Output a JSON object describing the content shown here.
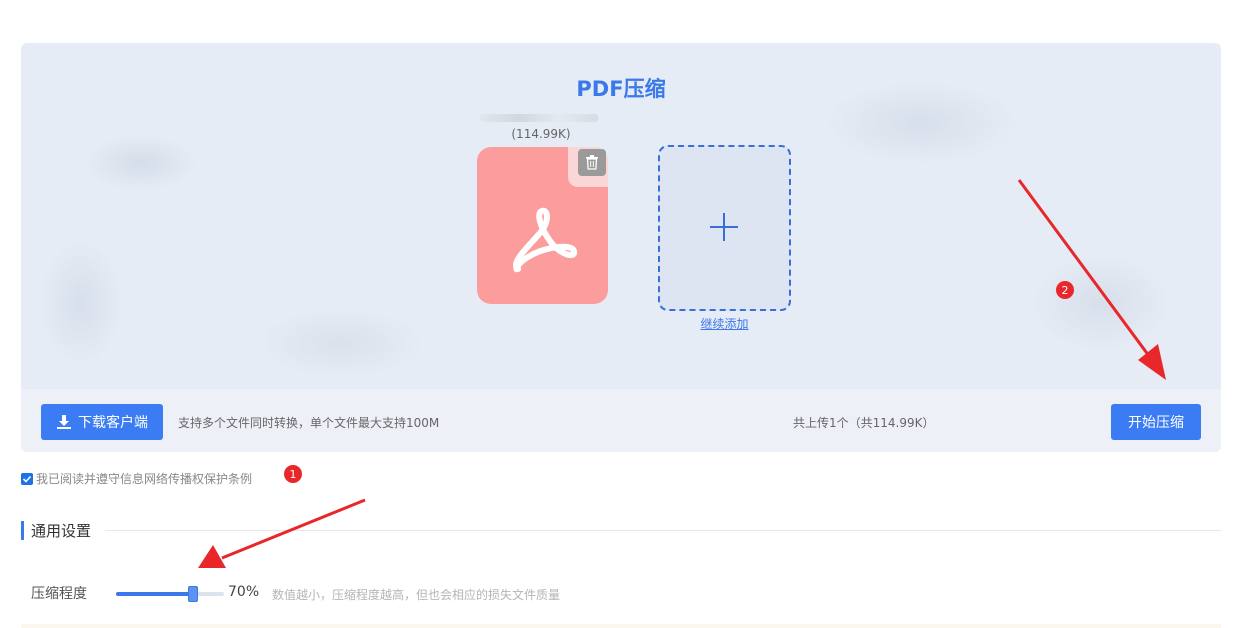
{
  "header": {
    "title": "PDF压缩"
  },
  "file": {
    "size": "(114.99K)",
    "icon": "pdf-icon"
  },
  "add_more": {
    "label": "继续添加"
  },
  "toolbar": {
    "download_label": "下载客户端",
    "support_text": "支持多个文件同时转换，单个文件最大支持100M",
    "upload_count": "共上传1个（共114.99K）",
    "start_label": "开始压缩"
  },
  "agreement": {
    "label": "我已阅读并遵守信息网络传播权保护条例",
    "checked": true
  },
  "settings": {
    "section_title": "通用设置",
    "compression": {
      "label": "压缩程度",
      "value": 70,
      "value_text": "70%",
      "hint": "数值越小，压缩程度越高，但也会相应的损失文件质量"
    }
  },
  "annotations": {
    "badge_1": "1",
    "badge_2": "2"
  },
  "colors": {
    "accent": "#3b79ea",
    "button": "#3b7cf4",
    "file_card": "#fb9d9d",
    "badge": "#e8272a"
  }
}
